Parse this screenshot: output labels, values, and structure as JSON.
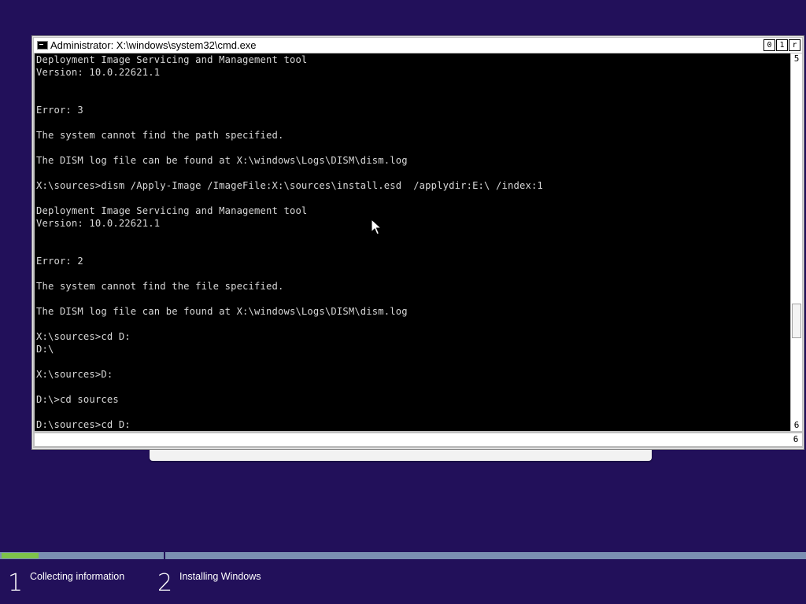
{
  "window": {
    "title": "Administrator: X:\\windows\\system32\\cmd.exe",
    "buttons": [
      "0",
      "1",
      "r"
    ],
    "icon": "cmd-icon"
  },
  "console": {
    "lines": [
      "Deployment Image Servicing and Management tool",
      "Version: 10.0.22621.1",
      "",
      "",
      "Error: 3",
      "",
      "The system cannot find the path specified.",
      "",
      "The DISM log file can be found at X:\\windows\\Logs\\DISM\\dism.log",
      "",
      "X:\\sources>dism /Apply-Image /ImageFile:X:\\sources\\install.esd  /applydir:E:\\ /index:1",
      "",
      "Deployment Image Servicing and Management tool",
      "Version: 10.0.22621.1",
      "",
      "",
      "Error: 2",
      "",
      "The system cannot find the file specified.",
      "",
      "The DISM log file can be found at X:\\windows\\Logs\\DISM\\dism.log",
      "",
      "X:\\sources>cd D:",
      "D:\\",
      "",
      "X:\\sources>D:",
      "",
      "D:\\>cd sources",
      "",
      "D:\\sources>cd D:"
    ]
  },
  "scrollbar": {
    "up_arrow": "5",
    "down_arrow": "6",
    "h_arrow": "6"
  },
  "setup": {
    "steps": [
      {
        "number": "1",
        "label": "Collecting information"
      },
      {
        "number": "2",
        "label": "Installing Windows"
      }
    ],
    "progress_fraction": 0.23,
    "colors": {
      "background": "#22105a",
      "progress_track": "#7b8fb2",
      "progress_fill": "#7ec24a"
    }
  }
}
